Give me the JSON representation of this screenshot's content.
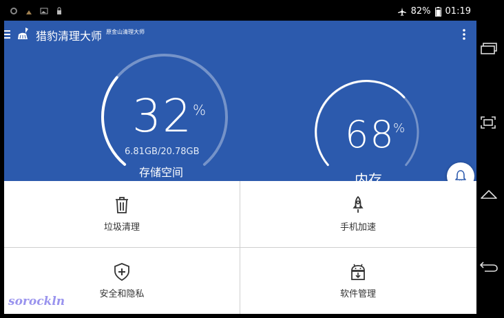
{
  "status_bar": {
    "battery": "82%",
    "time": "01:19"
  },
  "app_bar": {
    "title": "猎豹清理大师",
    "subtitle": "原金山清理大师"
  },
  "storage": {
    "percent": "32",
    "percent_sign": "%",
    "usage": "6.81GB/20.78GB",
    "label": "存储空间",
    "fill_fraction": 0.32
  },
  "memory": {
    "percent": "68",
    "percent_sign": "%",
    "label": "内存",
    "fill_fraction": 0.68
  },
  "tiles": {
    "junk": "垃圾清理",
    "boost": "手机加速",
    "security": "安全和隐私",
    "apps": "软件管理"
  },
  "watermark": "sorockln",
  "colors": {
    "primary": "#2c5aad"
  }
}
